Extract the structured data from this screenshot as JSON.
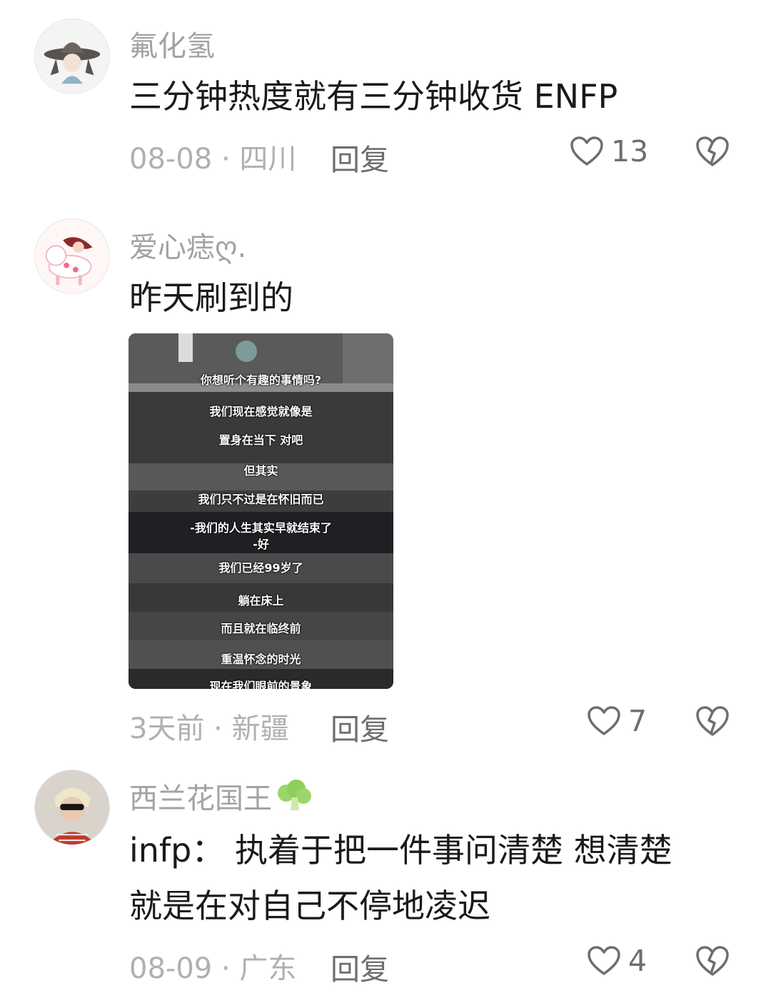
{
  "comments": [
    {
      "username": "氟化氢",
      "text": "三分钟热度就有三分钟收货 ENFP",
      "meta": "08-08 · 四川",
      "reply": "回复",
      "likes": "13"
    },
    {
      "username": "爱心痣ღ.",
      "text": "昨天刷到的",
      "meta": "3天前 · 新疆",
      "reply": "回复",
      "likes": "7",
      "image_captions": [
        "你想听个有趣的事情吗?",
        "我们现在感觉就像是",
        "置身在当下 对吧",
        "但其实",
        "我们只不过是在怀旧而已",
        "-我们的人生其实早就结束了",
        "-好",
        "我们已经99岁了",
        "躺在床上",
        "而且就在临终前",
        "重温怀念的时光",
        "现在我们眼前的景象"
      ]
    },
    {
      "username": "西兰花国王",
      "username_emoji": "broccoli-icon",
      "text_line1": "infp： 执着于把一件事问清楚 想清楚",
      "text_line2": "就是在对自己不停地凌迟",
      "meta": "08-09 · 广东",
      "reply": "回复",
      "likes": "4"
    }
  ],
  "colors": {
    "username": "#a3a3a3",
    "text": "#1a1a1a",
    "meta": "#b0b0b0",
    "action": "#6e6e6e"
  }
}
